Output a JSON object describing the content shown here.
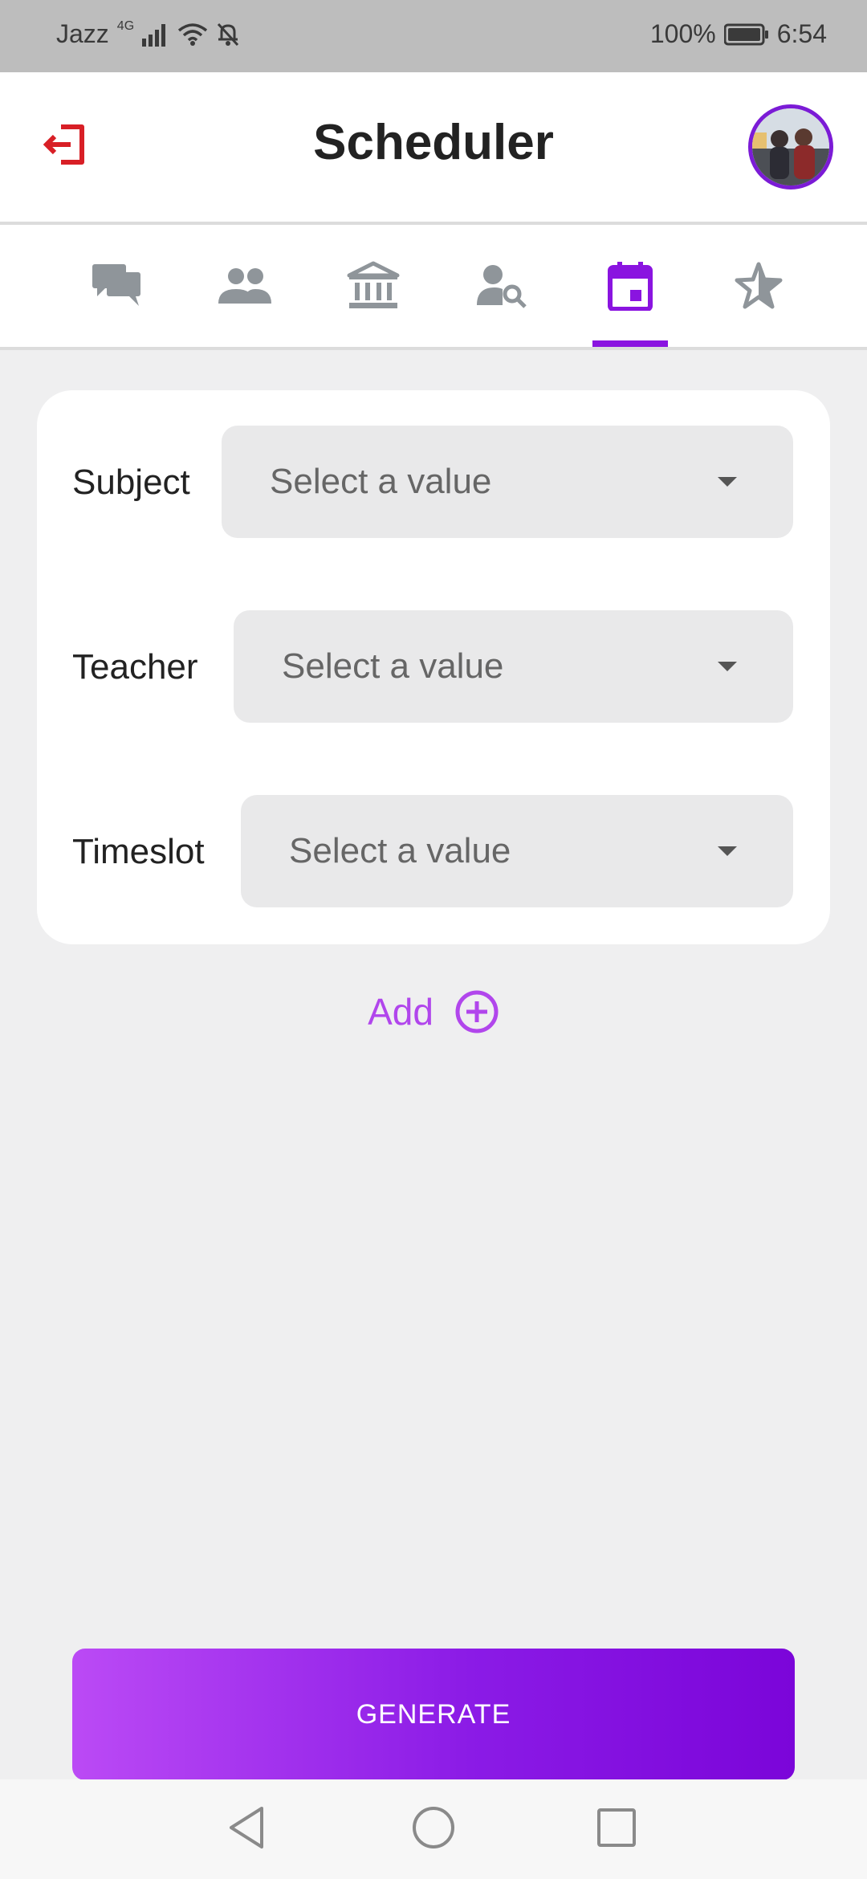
{
  "status_bar": {
    "carrier": "Jazz",
    "network": "4G",
    "battery": "100%",
    "time": "6:54"
  },
  "header": {
    "title": "Scheduler",
    "logout_icon": "logout-icon",
    "avatar": "user-avatar"
  },
  "tabs": [
    {
      "icon": "chat-icon",
      "active": false
    },
    {
      "icon": "people-icon",
      "active": false
    },
    {
      "icon": "institution-icon",
      "active": false
    },
    {
      "icon": "person-search-icon",
      "active": false
    },
    {
      "icon": "calendar-icon",
      "active": true
    },
    {
      "icon": "star-icon",
      "active": false
    }
  ],
  "form": {
    "fields": [
      {
        "label": "Subject",
        "placeholder": "Select a value"
      },
      {
        "label": "Teacher",
        "placeholder": "Select a value"
      },
      {
        "label": "Timeslot",
        "placeholder": "Select a value"
      }
    ],
    "add_label": "Add"
  },
  "actions": {
    "generate_label": "GENERATE"
  },
  "colors": {
    "accent": "#8a14e0",
    "add": "#b146ec",
    "logout": "#d81f26"
  }
}
